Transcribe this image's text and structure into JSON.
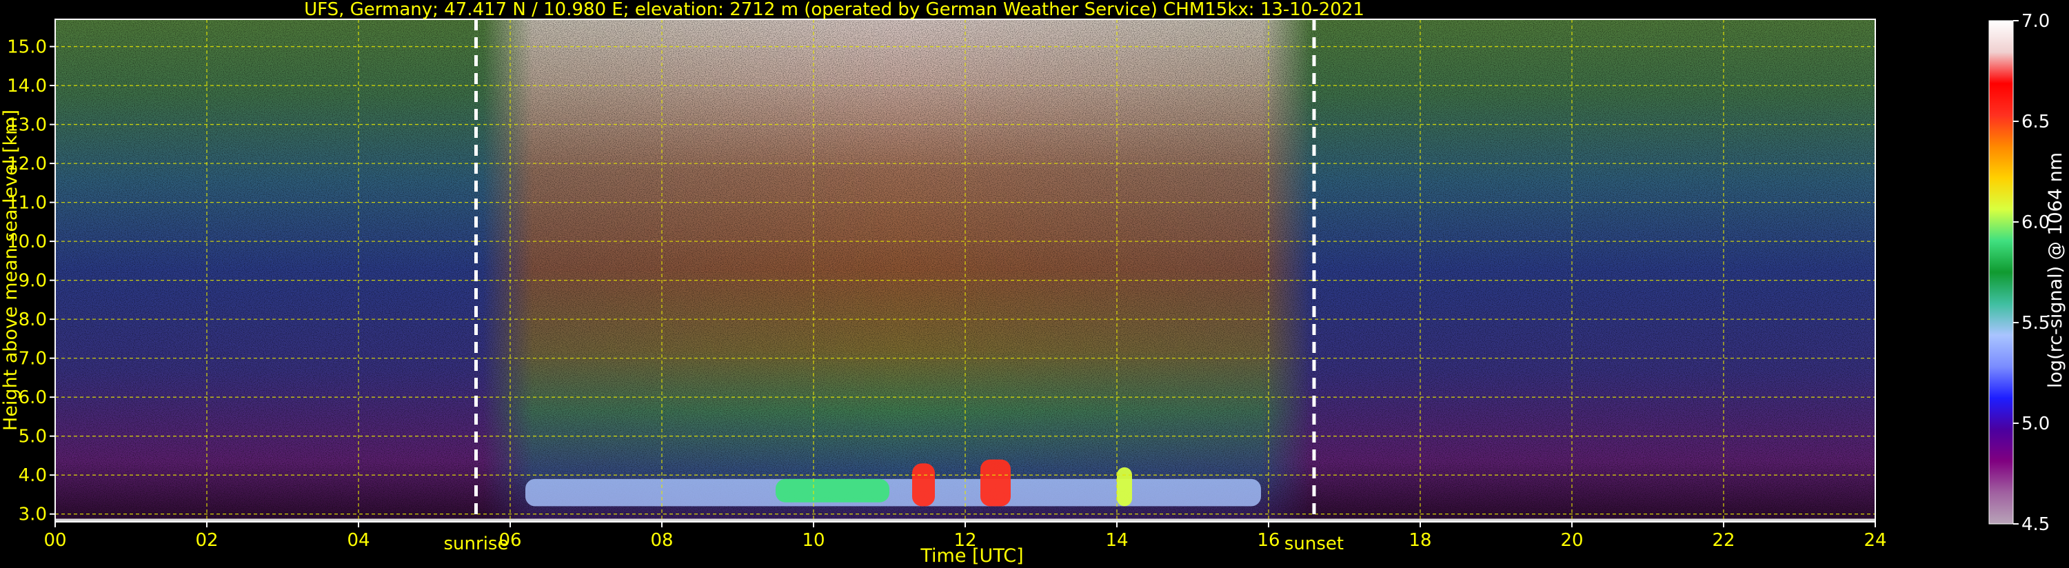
{
  "chart_data": {
    "type": "heatmap",
    "title": "UFS, Germany; 47.417 N / 10.980 E; elevation: 2712 m  (operated by German Weather Service)    CHM15kx: 13-10-2021",
    "xlabel": "Time [UTC]",
    "ylabel": "Height above mean sea level [km]",
    "xlim": [
      0,
      24
    ],
    "ylim": [
      2.8,
      15.7
    ],
    "x_ticks": [
      "00",
      "02",
      "04",
      "06",
      "08",
      "10",
      "12",
      "14",
      "16",
      "18",
      "20",
      "22",
      "24"
    ],
    "y_ticks": [
      "3.0",
      "4.0",
      "5.0",
      "6.0",
      "7.0",
      "8.0",
      "9.0",
      "10.0",
      "11.0",
      "12.0",
      "13.0",
      "14.0",
      "15.0"
    ],
    "grid": true,
    "colorbar": {
      "label": "log(rc-signal) @ 1064 nm",
      "range": [
        4.5,
        7.0
      ],
      "ticks": [
        "4.5",
        "5.0",
        "5.5",
        "6.0",
        "6.5",
        "7.0"
      ]
    },
    "events": [
      {
        "label": "sunrise",
        "time": 5.55
      },
      {
        "label": "sunset",
        "time": 16.6
      }
    ],
    "cloud_layers": [
      {
        "start": 6.2,
        "end": 15.9,
        "base_km": 3.2,
        "top_km": 3.9,
        "level": 5.5
      },
      {
        "start": 9.5,
        "end": 11.0,
        "base_km": 3.3,
        "top_km": 3.9,
        "level": 5.9
      },
      {
        "start": 11.3,
        "end": 11.6,
        "base_km": 3.2,
        "top_km": 4.3,
        "level": 6.6
      },
      {
        "start": 12.2,
        "end": 12.6,
        "base_km": 3.2,
        "top_km": 4.4,
        "level": 6.6
      },
      {
        "start": 14.0,
        "end": 14.2,
        "base_km": 3.2,
        "top_km": 4.2,
        "level": 6.1
      }
    ],
    "colors": {
      "axis_text": "#ffff00",
      "grid": "#e6e600",
      "event_lines": "#ffffff",
      "colorbar": [
        "#b8a4b8",
        "#a060a0",
        "#800080",
        "#4b00a0",
        "#1e1eff",
        "#7a8cff",
        "#a9c4ff",
        "#3fbfa0",
        "#109a30",
        "#40e080",
        "#d8ff40",
        "#ffd000",
        "#ff8800",
        "#ff3020",
        "#ff0000",
        "#f0d0d0",
        "#ffffff"
      ]
    }
  }
}
